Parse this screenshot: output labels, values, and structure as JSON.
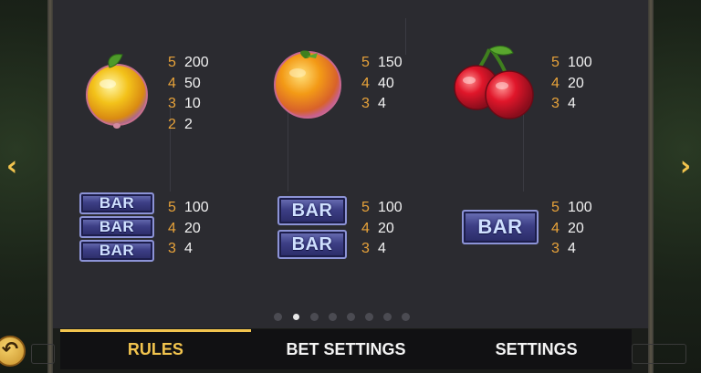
{
  "paytable": {
    "lemon": {
      "icon": "lemon-icon",
      "pays": [
        {
          "count": "5",
          "value": "200"
        },
        {
          "count": "4",
          "value": "50"
        },
        {
          "count": "3",
          "value": "10"
        },
        {
          "count": "2",
          "value": "2"
        }
      ]
    },
    "orange": {
      "icon": "orange-icon",
      "pays": [
        {
          "count": "5",
          "value": "150"
        },
        {
          "count": "4",
          "value": "40"
        },
        {
          "count": "3",
          "value": "4"
        }
      ]
    },
    "cherry": {
      "icon": "cherry-icon",
      "pays": [
        {
          "count": "5",
          "value": "100"
        },
        {
          "count": "4",
          "value": "20"
        },
        {
          "count": "3",
          "value": "4"
        }
      ]
    },
    "triple_bar": {
      "label": "BAR",
      "pays": [
        {
          "count": "5",
          "value": "100"
        },
        {
          "count": "4",
          "value": "20"
        },
        {
          "count": "3",
          "value": "4"
        }
      ]
    },
    "double_bar": {
      "label": "BAR",
      "pays": [
        {
          "count": "5",
          "value": "100"
        },
        {
          "count": "4",
          "value": "20"
        },
        {
          "count": "3",
          "value": "4"
        }
      ]
    },
    "single_bar": {
      "label": "BAR",
      "pays": [
        {
          "count": "5",
          "value": "100"
        },
        {
          "count": "4",
          "value": "20"
        },
        {
          "count": "3",
          "value": "4"
        }
      ]
    }
  },
  "pager": {
    "total_pages": 8,
    "active_index": 1
  },
  "nav": {
    "tabs": [
      {
        "label": "RULES"
      },
      {
        "label": "BET SETTINGS"
      },
      {
        "label": "SETTINGS"
      }
    ],
    "active": 0
  },
  "colors": {
    "accent": "#f2c44e",
    "count_color": "#e8a33a",
    "panel": "#2b2b30",
    "bar_blue": "#3d3f86"
  }
}
